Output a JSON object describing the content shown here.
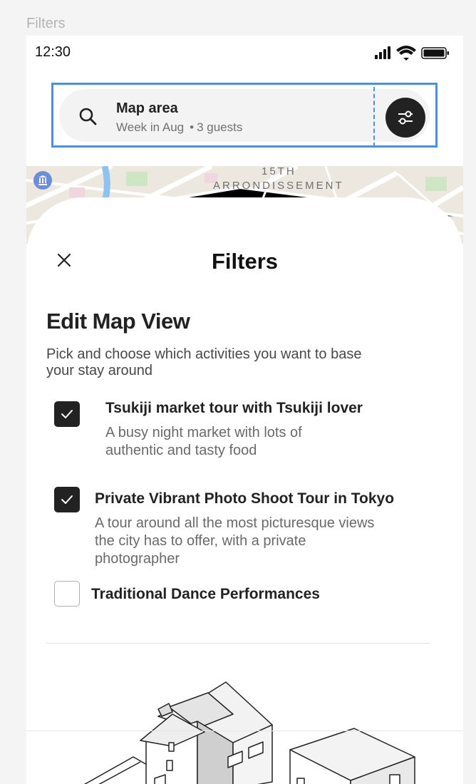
{
  "frame_label": "Filters",
  "status_bar": {
    "time": "12:30"
  },
  "search": {
    "title": "Map area",
    "dates": "Week in Aug",
    "separator": "•",
    "guests": "3 guests"
  },
  "map": {
    "label_line1": "15TH",
    "label_line2": "ARRONDISSEMENT"
  },
  "sheet": {
    "title": "Filters",
    "section_title": "Edit Map View",
    "section_desc": "Pick and choose which activities you want to base your stay around",
    "activities": [
      {
        "title": "Tsukiji market tour with Tsukiji lover",
        "desc": "A busy night market with lots of authentic and tasty food",
        "checked": true
      },
      {
        "title": "Private Vibrant Photo Shoot Tour in Tokyo",
        "desc": "A tour around all the most picturesque views the city has to offer, with a private photographer",
        "checked": true
      },
      {
        "title": "Traditional Dance Performances",
        "desc": "",
        "checked": false
      }
    ]
  },
  "icons": {
    "search": "search-icon",
    "filter": "sliders-icon",
    "close": "close-icon",
    "check": "check-icon",
    "museum": "museum-icon"
  },
  "colors": {
    "selection_outline": "#4a90e2",
    "checkbox_checked": "#222222",
    "filter_button": "#222222"
  }
}
